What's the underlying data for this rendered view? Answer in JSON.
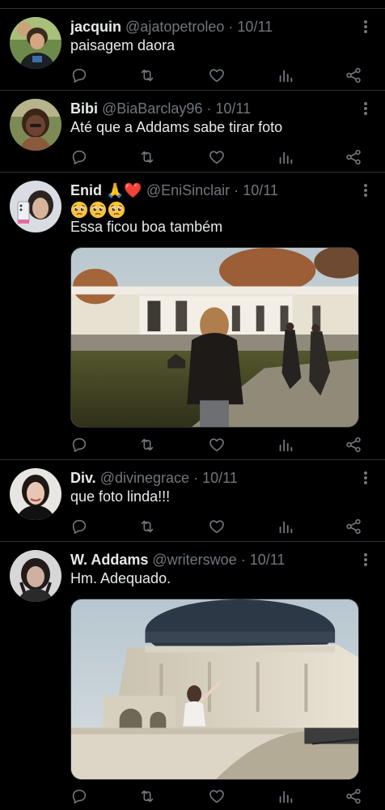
{
  "tweets": [
    {
      "name": "jacquin",
      "handle": "@ajatopetroleo",
      "separator": "·",
      "date": "10/11",
      "text": "paisagem daora"
    },
    {
      "name": "Bibi",
      "handle": "@BiaBarclay96",
      "separator": "·",
      "date": "10/11",
      "text": "Até que a Addams sabe tirar foto"
    },
    {
      "name": "Enid 🙏❤️",
      "handle": "@EniSinclair",
      "separator": "·",
      "date": "10/11",
      "text": "Essa ficou boa também"
    },
    {
      "name": "Div.",
      "handle": "@divinegrace",
      "separator": "·",
      "date": "10/11",
      "text": "que foto linda!!!"
    },
    {
      "name": "W. Addams",
      "handle": "@writerswoe",
      "separator": "·",
      "date": "10/11",
      "text": "Hm. Adequado."
    }
  ],
  "icons": {
    "reply": "reply-icon",
    "retweet": "retweet-icon",
    "like": "heart-icon",
    "stats": "stats-icon",
    "share": "share-icon",
    "more": "more-icon"
  },
  "colors": {
    "background": "#000000",
    "text": "#e7e9ea",
    "muted": "#71767b",
    "divider": "#2f3336"
  }
}
